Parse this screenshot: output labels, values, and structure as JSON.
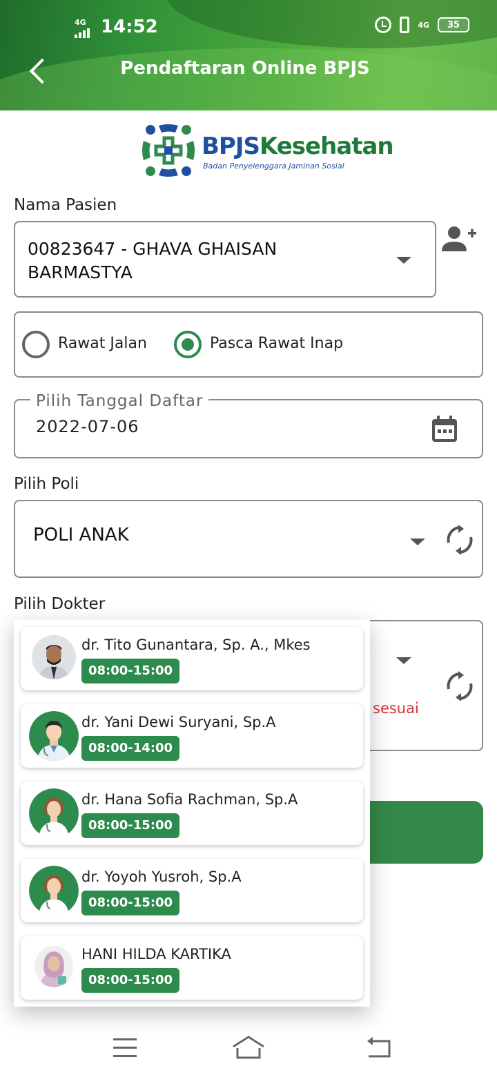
{
  "status_bar": {
    "time": "14:52",
    "signal_label": "4G",
    "network_label": "4G",
    "battery": "35"
  },
  "header": {
    "title": "Pendaftaran Online BPJS"
  },
  "logo": {
    "name_left": "BPJS",
    "name_right": "Kesehatan",
    "subtitle": "Badan Penyelenggara Jaminan Sosial"
  },
  "patient": {
    "label": "Nama Pasien",
    "value_line1": "00823647 - GHAVA GHAISAN",
    "value_line2": "BARMASTYA"
  },
  "care_type": {
    "options": [
      {
        "label": "Rawat Jalan",
        "selected": false
      },
      {
        "label": "Pasca Rawat Inap",
        "selected": true
      }
    ]
  },
  "date": {
    "label": "Pilih Tanggal Daftar",
    "value": "2022-07-06"
  },
  "poli": {
    "label": "Pilih Poli",
    "value": "POLI ANAK"
  },
  "doctor": {
    "label": "Pilih Dokter",
    "error_fragment": "sesuai",
    "list": [
      {
        "name": "dr. Tito Gunantara, Sp. A., Mkes",
        "time": "08:00-15:00",
        "avatar": "photo-male"
      },
      {
        "name": "dr. Yani Dewi Suryani, Sp.A",
        "time": "08:00-14:00",
        "avatar": "doctor-male-icon"
      },
      {
        "name": "dr. Hana Sofia Rachman, Sp.A",
        "time": "08:00-15:00",
        "avatar": "doctor-female-icon"
      },
      {
        "name": "dr. Yoyoh Yusroh, Sp.A",
        "time": "08:00-15:00",
        "avatar": "doctor-female-icon"
      },
      {
        "name": "HANI HILDA KARTIKA",
        "time": "08:00-15:00",
        "avatar": "photo-female"
      }
    ]
  },
  "colors": {
    "accent": "#2e8b4e",
    "button": "#33894a",
    "error": "#d9343a",
    "header_dark": "#1f6b2a",
    "header_light": "#6ec04e"
  }
}
